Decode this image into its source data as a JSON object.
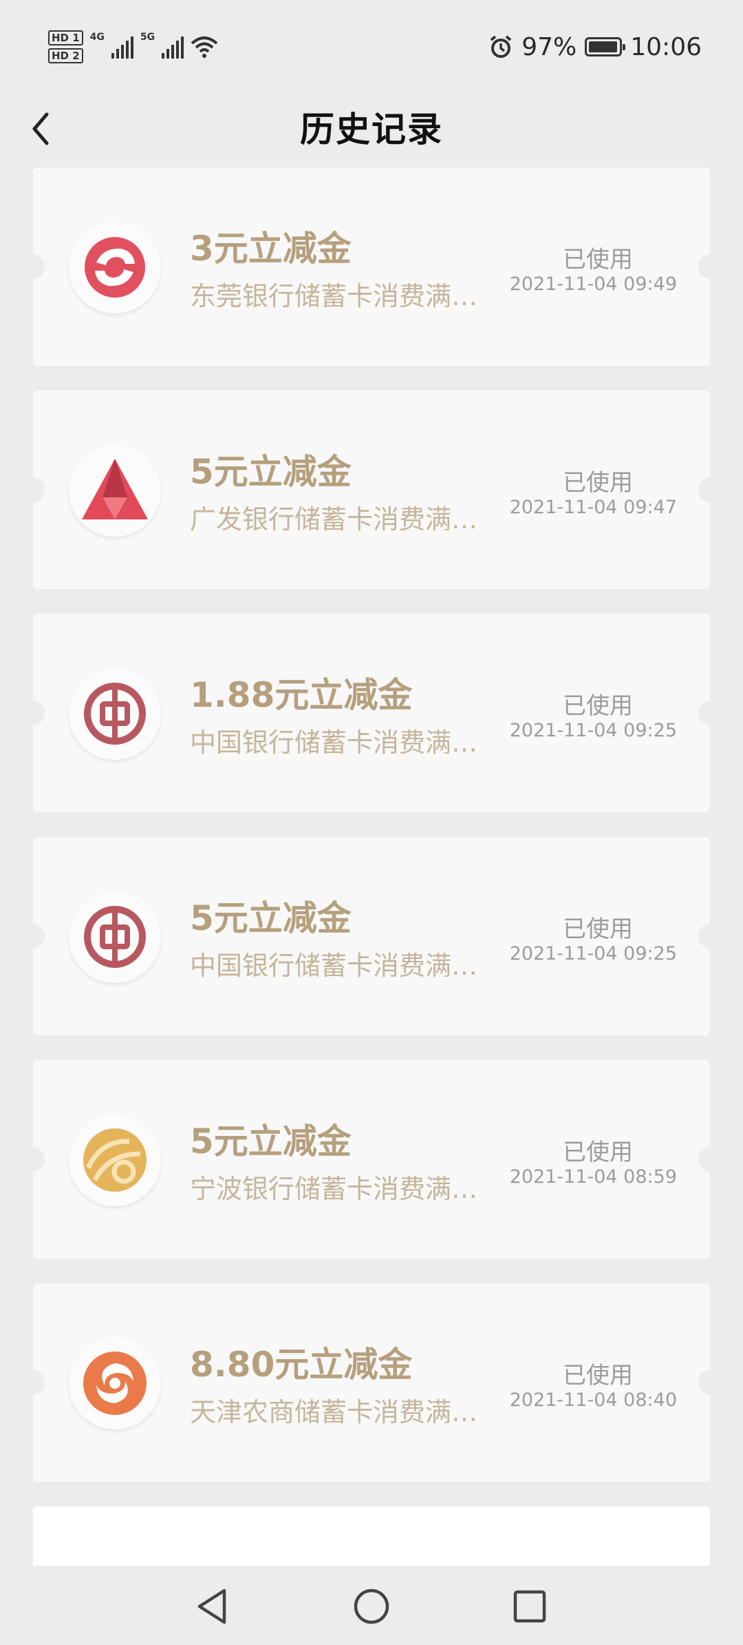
{
  "status_bar": {
    "hd1": "HD 1",
    "hd2": "HD 2",
    "net1": "4G",
    "net2": "5G",
    "battery_percent": "97%",
    "battery_level": 0.97,
    "time": "10:06"
  },
  "header": {
    "title": "历史记录"
  },
  "coupons": [
    {
      "amount": "3元立减金",
      "desc": "东莞银行储蓄卡消费满…",
      "status": "已使用",
      "time": "2021-11-04 09:49",
      "bank_icon": "dongguan-bank-logo-icon",
      "color": "#e2505f"
    },
    {
      "amount": "5元立减金",
      "desc": "广发银行储蓄卡消费满…",
      "status": "已使用",
      "time": "2021-11-04 09:47",
      "bank_icon": "cgb-bank-logo-icon",
      "color": "#e24a5a"
    },
    {
      "amount": "1.88元立减金",
      "desc": "中国银行储蓄卡消费满…",
      "status": "已使用",
      "time": "2021-11-04 09:25",
      "bank_icon": "boc-bank-logo-icon",
      "color": "#b7585f"
    },
    {
      "amount": "5元立减金",
      "desc": "中国银行储蓄卡消费满…",
      "status": "已使用",
      "time": "2021-11-04 09:25",
      "bank_icon": "boc-bank-logo-icon",
      "color": "#b7585f"
    },
    {
      "amount": "5元立减金",
      "desc": "宁波银行储蓄卡消费满…",
      "status": "已使用",
      "time": "2021-11-04 08:59",
      "bank_icon": "ningbo-bank-logo-icon",
      "color": "#e5b45a"
    },
    {
      "amount": "8.80元立减金",
      "desc": "天津农商储蓄卡消费满…",
      "status": "已使用",
      "time": "2021-11-04 08:40",
      "bank_icon": "tianjin-rural-bank-logo-icon",
      "color": "#ea7a4a"
    }
  ],
  "nav": {
    "back_icon": "triangle-back-icon",
    "home_icon": "circle-home-icon",
    "recents_icon": "square-recents-icon"
  }
}
